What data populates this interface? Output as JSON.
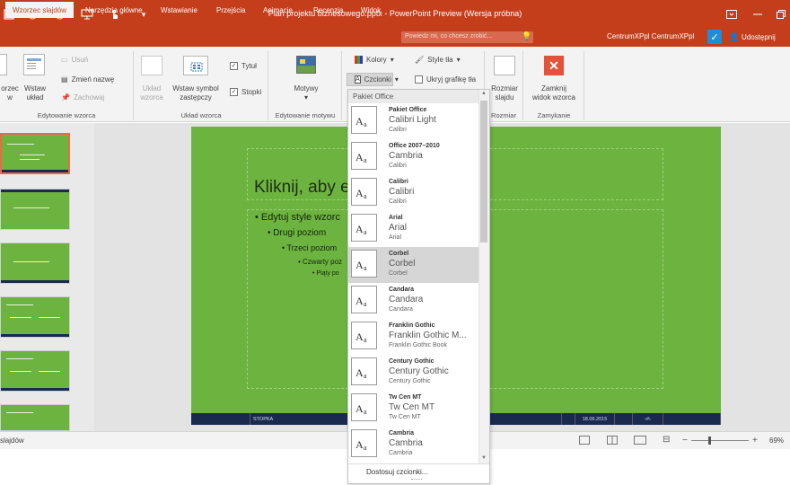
{
  "window": {
    "title": "Plan projektu biznesowego.pptx - PowerPoint Preview (Wersja próbna)",
    "qat": [
      "save-icon",
      "undo-icon",
      "redo-icon",
      "present-icon",
      "touch-icon",
      "customize-icon"
    ]
  },
  "tabs": [
    {
      "label": "Wzorzec slajdów",
      "active": true
    },
    {
      "label": "Narzędzia główne"
    },
    {
      "label": "Wstawianie"
    },
    {
      "label": "Przejścia"
    },
    {
      "label": "Animacje"
    },
    {
      "label": "Recenzja"
    },
    {
      "label": "Widok"
    }
  ],
  "tellme": "Powiedz mi, co chcesz zrobić...",
  "account": "CentrumXPpl CentrumXPpl",
  "share": "Udostępnij",
  "ribbon": {
    "edit_master": {
      "insert_master": "orzec\nw",
      "insert_layout": "Wstaw\nukład",
      "delete": "Usuń",
      "rename": "Zmień nazwę",
      "preserve": "Zachowaj",
      "group": "Edytowanie wzorca"
    },
    "master_layout": {
      "layout_master": "Układ\nwzorca",
      "insert_placeholder": "Wstaw symbol\nzastępczy",
      "title_chk": "Tytuł",
      "footers_chk": "Stopki",
      "group": "Układ wzorca"
    },
    "edit_theme": {
      "themes": "Motywy",
      "group": "Edytowanie motywu"
    },
    "background": {
      "colors": "Kolory",
      "fonts": "Czcionki",
      "bg_styles": "Style tła",
      "hide_bg": "Ukryj grafikę tła"
    },
    "size": {
      "slide_size": "Rozmiar\nslajdu",
      "group": "Rozmiar"
    },
    "close": {
      "close_master": "Zamknij\nwidok wzorca",
      "group": "Zamykanie"
    }
  },
  "slide": {
    "title": "Kliknij, aby e",
    "levels": [
      "Edytuj style wzorc",
      "Drugi poziom",
      "Trzeci poziom",
      "Czwarty poz",
      "Piąty po"
    ],
    "footer": "STOPKA",
    "date": "18.06.2015",
    "num": "‹#›"
  },
  "status": {
    "left": "slajdów",
    "zoom": "69%"
  },
  "font_menu": {
    "header": "Pakiet Office",
    "items": [
      {
        "name": "Pakiet Office",
        "heading": "Calibri Light",
        "body": "Calibri"
      },
      {
        "name": "Office 2007–2010",
        "heading": "Cambria",
        "body": "Calibri"
      },
      {
        "name": "Calibri",
        "heading": "Calibri",
        "body": "Calibri"
      },
      {
        "name": "Arial",
        "heading": "Arial",
        "body": "Arial"
      },
      {
        "name": "Corbel",
        "heading": "Corbel",
        "body": "Corbel",
        "highlight": true
      },
      {
        "name": "Candara",
        "heading": "Candara",
        "body": "Candara"
      },
      {
        "name": "Franklin Gothic",
        "heading": "Franklin Gothic M...",
        "body": "Franklin Gothic Book"
      },
      {
        "name": "Century Gothic",
        "heading": "Century Gothic",
        "body": "Century Gothic"
      },
      {
        "name": "Tw Cen MT",
        "heading": "Tw Cen MT",
        "body": "Tw Cen MT"
      },
      {
        "name": "Cambria",
        "heading": "Cambria",
        "body": "Cambria"
      }
    ],
    "customize": "Dostosuj czcionki..."
  },
  "colors": {
    "accent": "#c43e1c",
    "slide_bg": "#6db33f",
    "footer_bar": "#1a2a4f"
  }
}
